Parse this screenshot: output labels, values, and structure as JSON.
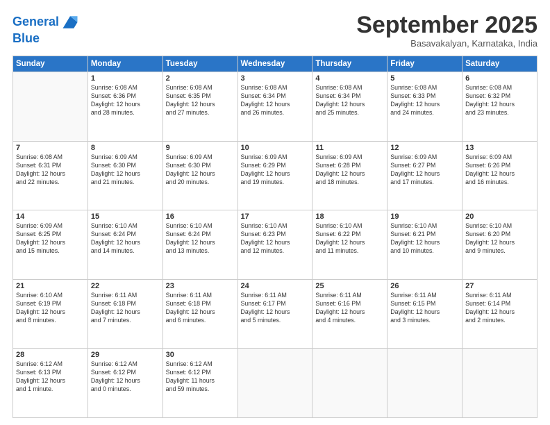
{
  "logo": {
    "line1": "General",
    "line2": "Blue"
  },
  "title": "September 2025",
  "subtitle": "Basavakalyan, Karnataka, India",
  "days_of_week": [
    "Sunday",
    "Monday",
    "Tuesday",
    "Wednesday",
    "Thursday",
    "Friday",
    "Saturday"
  ],
  "weeks": [
    [
      {
        "day": "",
        "info": ""
      },
      {
        "day": "1",
        "info": "Sunrise: 6:08 AM\nSunset: 6:36 PM\nDaylight: 12 hours\nand 28 minutes."
      },
      {
        "day": "2",
        "info": "Sunrise: 6:08 AM\nSunset: 6:35 PM\nDaylight: 12 hours\nand 27 minutes."
      },
      {
        "day": "3",
        "info": "Sunrise: 6:08 AM\nSunset: 6:34 PM\nDaylight: 12 hours\nand 26 minutes."
      },
      {
        "day": "4",
        "info": "Sunrise: 6:08 AM\nSunset: 6:34 PM\nDaylight: 12 hours\nand 25 minutes."
      },
      {
        "day": "5",
        "info": "Sunrise: 6:08 AM\nSunset: 6:33 PM\nDaylight: 12 hours\nand 24 minutes."
      },
      {
        "day": "6",
        "info": "Sunrise: 6:08 AM\nSunset: 6:32 PM\nDaylight: 12 hours\nand 23 minutes."
      }
    ],
    [
      {
        "day": "7",
        "info": "Sunrise: 6:08 AM\nSunset: 6:31 PM\nDaylight: 12 hours\nand 22 minutes."
      },
      {
        "day": "8",
        "info": "Sunrise: 6:09 AM\nSunset: 6:30 PM\nDaylight: 12 hours\nand 21 minutes."
      },
      {
        "day": "9",
        "info": "Sunrise: 6:09 AM\nSunset: 6:30 PM\nDaylight: 12 hours\nand 20 minutes."
      },
      {
        "day": "10",
        "info": "Sunrise: 6:09 AM\nSunset: 6:29 PM\nDaylight: 12 hours\nand 19 minutes."
      },
      {
        "day": "11",
        "info": "Sunrise: 6:09 AM\nSunset: 6:28 PM\nDaylight: 12 hours\nand 18 minutes."
      },
      {
        "day": "12",
        "info": "Sunrise: 6:09 AM\nSunset: 6:27 PM\nDaylight: 12 hours\nand 17 minutes."
      },
      {
        "day": "13",
        "info": "Sunrise: 6:09 AM\nSunset: 6:26 PM\nDaylight: 12 hours\nand 16 minutes."
      }
    ],
    [
      {
        "day": "14",
        "info": "Sunrise: 6:09 AM\nSunset: 6:25 PM\nDaylight: 12 hours\nand 15 minutes."
      },
      {
        "day": "15",
        "info": "Sunrise: 6:10 AM\nSunset: 6:24 PM\nDaylight: 12 hours\nand 14 minutes."
      },
      {
        "day": "16",
        "info": "Sunrise: 6:10 AM\nSunset: 6:24 PM\nDaylight: 12 hours\nand 13 minutes."
      },
      {
        "day": "17",
        "info": "Sunrise: 6:10 AM\nSunset: 6:23 PM\nDaylight: 12 hours\nand 12 minutes."
      },
      {
        "day": "18",
        "info": "Sunrise: 6:10 AM\nSunset: 6:22 PM\nDaylight: 12 hours\nand 11 minutes."
      },
      {
        "day": "19",
        "info": "Sunrise: 6:10 AM\nSunset: 6:21 PM\nDaylight: 12 hours\nand 10 minutes."
      },
      {
        "day": "20",
        "info": "Sunrise: 6:10 AM\nSunset: 6:20 PM\nDaylight: 12 hours\nand 9 minutes."
      }
    ],
    [
      {
        "day": "21",
        "info": "Sunrise: 6:10 AM\nSunset: 6:19 PM\nDaylight: 12 hours\nand 8 minutes."
      },
      {
        "day": "22",
        "info": "Sunrise: 6:11 AM\nSunset: 6:18 PM\nDaylight: 12 hours\nand 7 minutes."
      },
      {
        "day": "23",
        "info": "Sunrise: 6:11 AM\nSunset: 6:18 PM\nDaylight: 12 hours\nand 6 minutes."
      },
      {
        "day": "24",
        "info": "Sunrise: 6:11 AM\nSunset: 6:17 PM\nDaylight: 12 hours\nand 5 minutes."
      },
      {
        "day": "25",
        "info": "Sunrise: 6:11 AM\nSunset: 6:16 PM\nDaylight: 12 hours\nand 4 minutes."
      },
      {
        "day": "26",
        "info": "Sunrise: 6:11 AM\nSunset: 6:15 PM\nDaylight: 12 hours\nand 3 minutes."
      },
      {
        "day": "27",
        "info": "Sunrise: 6:11 AM\nSunset: 6:14 PM\nDaylight: 12 hours\nand 2 minutes."
      }
    ],
    [
      {
        "day": "28",
        "info": "Sunrise: 6:12 AM\nSunset: 6:13 PM\nDaylight: 12 hours\nand 1 minute."
      },
      {
        "day": "29",
        "info": "Sunrise: 6:12 AM\nSunset: 6:12 PM\nDaylight: 12 hours\nand 0 minutes."
      },
      {
        "day": "30",
        "info": "Sunrise: 6:12 AM\nSunset: 6:12 PM\nDaylight: 11 hours\nand 59 minutes."
      },
      {
        "day": "",
        "info": ""
      },
      {
        "day": "",
        "info": ""
      },
      {
        "day": "",
        "info": ""
      },
      {
        "day": "",
        "info": ""
      }
    ]
  ]
}
